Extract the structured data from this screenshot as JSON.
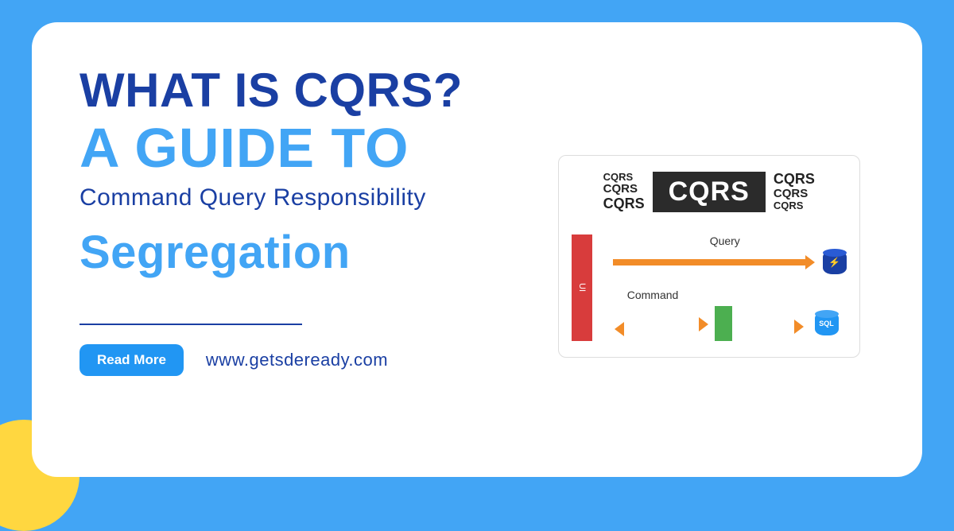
{
  "card": {
    "title_line1": "WHAT IS CQRS?",
    "title_line2": "A GUIDE TO",
    "subtitle": "Command Query Responsibility",
    "segregation": "Segregation",
    "read_more": "Read More",
    "url": "www.getsdeready.com"
  },
  "diagram": {
    "badge": "CQRS",
    "tag_small_left_1": "CQRS",
    "tag_small_left_2": "CQRS",
    "tag_small_left_3": "CQRS",
    "tag_small_right_1": "CQRS",
    "tag_small_right_2": "CQRS",
    "tag_small_right_3": "CQRS",
    "ui_label": "UI",
    "query_label": "Query",
    "command_label": "Command",
    "sql_label": "SQL",
    "bolt_icon": "⚡"
  }
}
